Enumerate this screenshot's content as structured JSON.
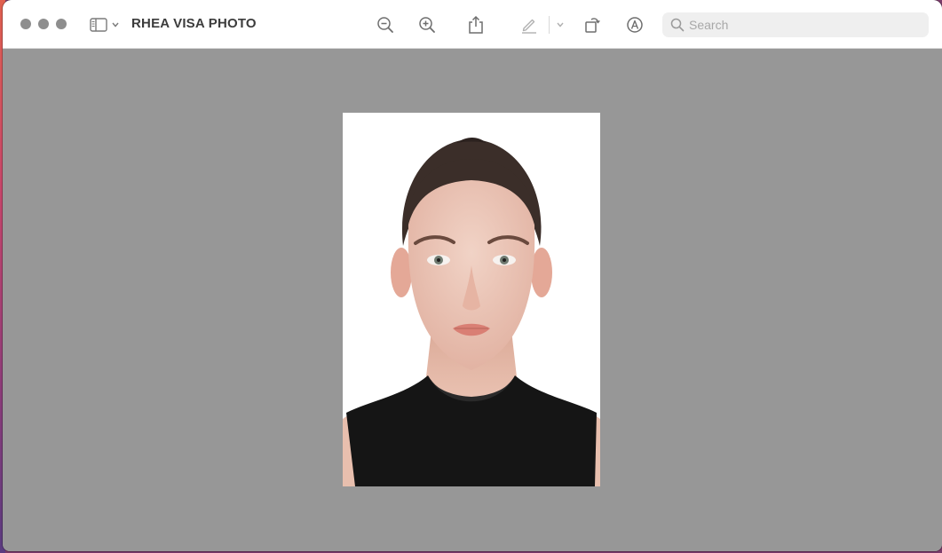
{
  "window": {
    "title": "RHEA VISA PHOTO"
  },
  "toolbar": {
    "items": [
      {
        "name": "zoom-out",
        "icon": "zoom-out-icon"
      },
      {
        "name": "zoom-in",
        "icon": "zoom-in-icon"
      },
      {
        "name": "share",
        "icon": "share-icon"
      },
      {
        "name": "highlight",
        "icon": "pencil-icon"
      },
      {
        "name": "highlight-menu",
        "icon": "chevron-down-icon"
      },
      {
        "name": "rotate",
        "icon": "rotate-icon"
      },
      {
        "name": "markup",
        "icon": "markup-icon"
      }
    ]
  },
  "search": {
    "placeholder": "Search",
    "value": ""
  },
  "colors": {
    "titlebar": "#ffffff",
    "content_background": "#979797",
    "traffic_lights": "#8e8e8e",
    "title_text": "#3c3c3c",
    "search_background": "#efefef"
  }
}
